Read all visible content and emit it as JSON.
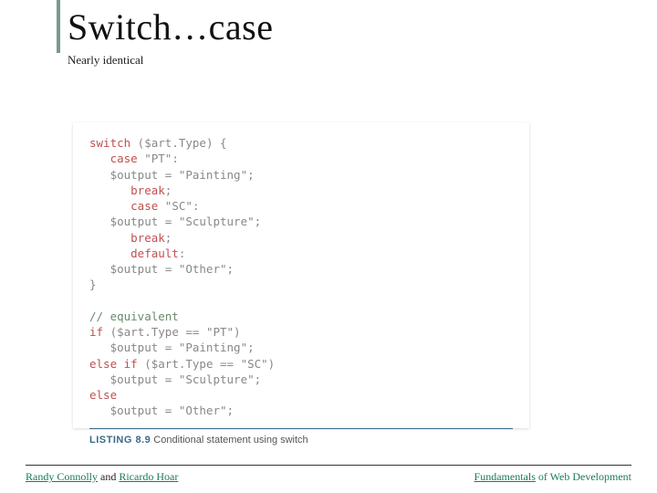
{
  "title": "Switch…case",
  "subtitle": "Nearly identical",
  "code": {
    "l1a": "switch",
    "l1b": " ($art.Type) {",
    "l2a": "   case",
    "l2b": " \"PT\":",
    "l3": "   $output = \"Painting\";",
    "l4": "      break",
    "l5a": "      case",
    "l5b": " \"SC\":",
    "l6": "   $output = \"Sculpture\";",
    "l7": "      break",
    "l8": "      default",
    "l9": "   $output = \"Other\";",
    "l10": "}",
    "blank": "",
    "l11": "// equivalent",
    "l12a": "if",
    "l12b": " ($art.Type == \"PT\")",
    "l13": "   $output = \"Painting\";",
    "l14a": "else if",
    "l14b": " ($art.Type == \"SC\")",
    "l15": "   $output = \"Sculpture\";",
    "l16": "else",
    "l17": "   $output = \"Other\";"
  },
  "caption_label": "LISTING 8.9",
  "caption_text": " Conditional statement using switch",
  "footer": {
    "author1": "Randy Connolly",
    "and": " and ",
    "author2": "Ricardo Hoar",
    "book1": "Fundamentals",
    "book2": " of Web Development"
  }
}
